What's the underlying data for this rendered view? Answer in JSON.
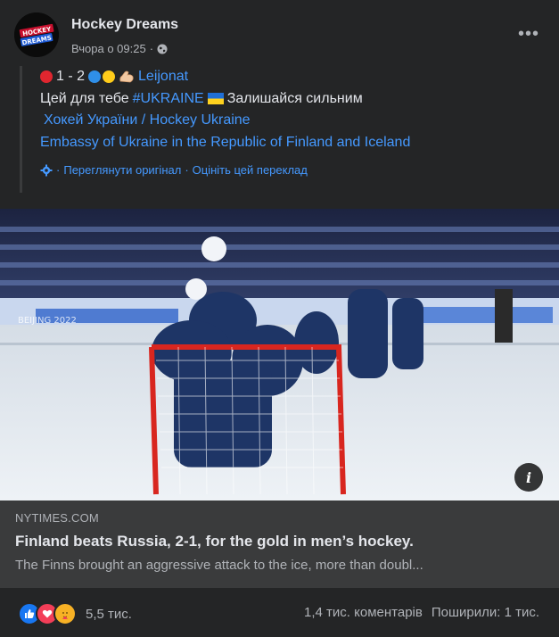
{
  "post": {
    "page_name": "Hockey Dreams",
    "avatar_text": "HOCKEY DREAMS",
    "timestamp": "Вчора о 09:25",
    "separator": "·",
    "audience_icon": "globe-icon",
    "more_icon": "more-icon",
    "more_label": "•••"
  },
  "text": {
    "score": "1 - 2",
    "score_link": "Leijonat",
    "line2_prefix": "Цей для тебе",
    "hashtag": "#UKRAINE",
    "line2_suffix": "Залишайся сильним",
    "mention1": "Хокей України / Hockey Ukraine",
    "mention2": "Embassy of Ukraine in the Republic of Finland and Iceland",
    "translate_view": "Переглянути оригінал",
    "translate_dot": "·",
    "translate_rate": "Оцініть цей переклад",
    "translate_sep": "·"
  },
  "link_preview": {
    "domain": "NYTIMES.COM",
    "headline": "Finland beats Russia, 2-1, for the gold in men’s hockey.",
    "description": "The Finns brought an aggressive attack to the ice, more than doubl..."
  },
  "image": {
    "info_label": "i"
  },
  "footer": {
    "reaction_count": "5,5 тис.",
    "comments": "1,4 тис. коментарів",
    "shares": "Поширили: 1 тис."
  },
  "colors": {
    "background": "#242526",
    "link": "#4599ff",
    "muted": "#b0b3b8",
    "preview_bg": "#3a3b3c"
  }
}
